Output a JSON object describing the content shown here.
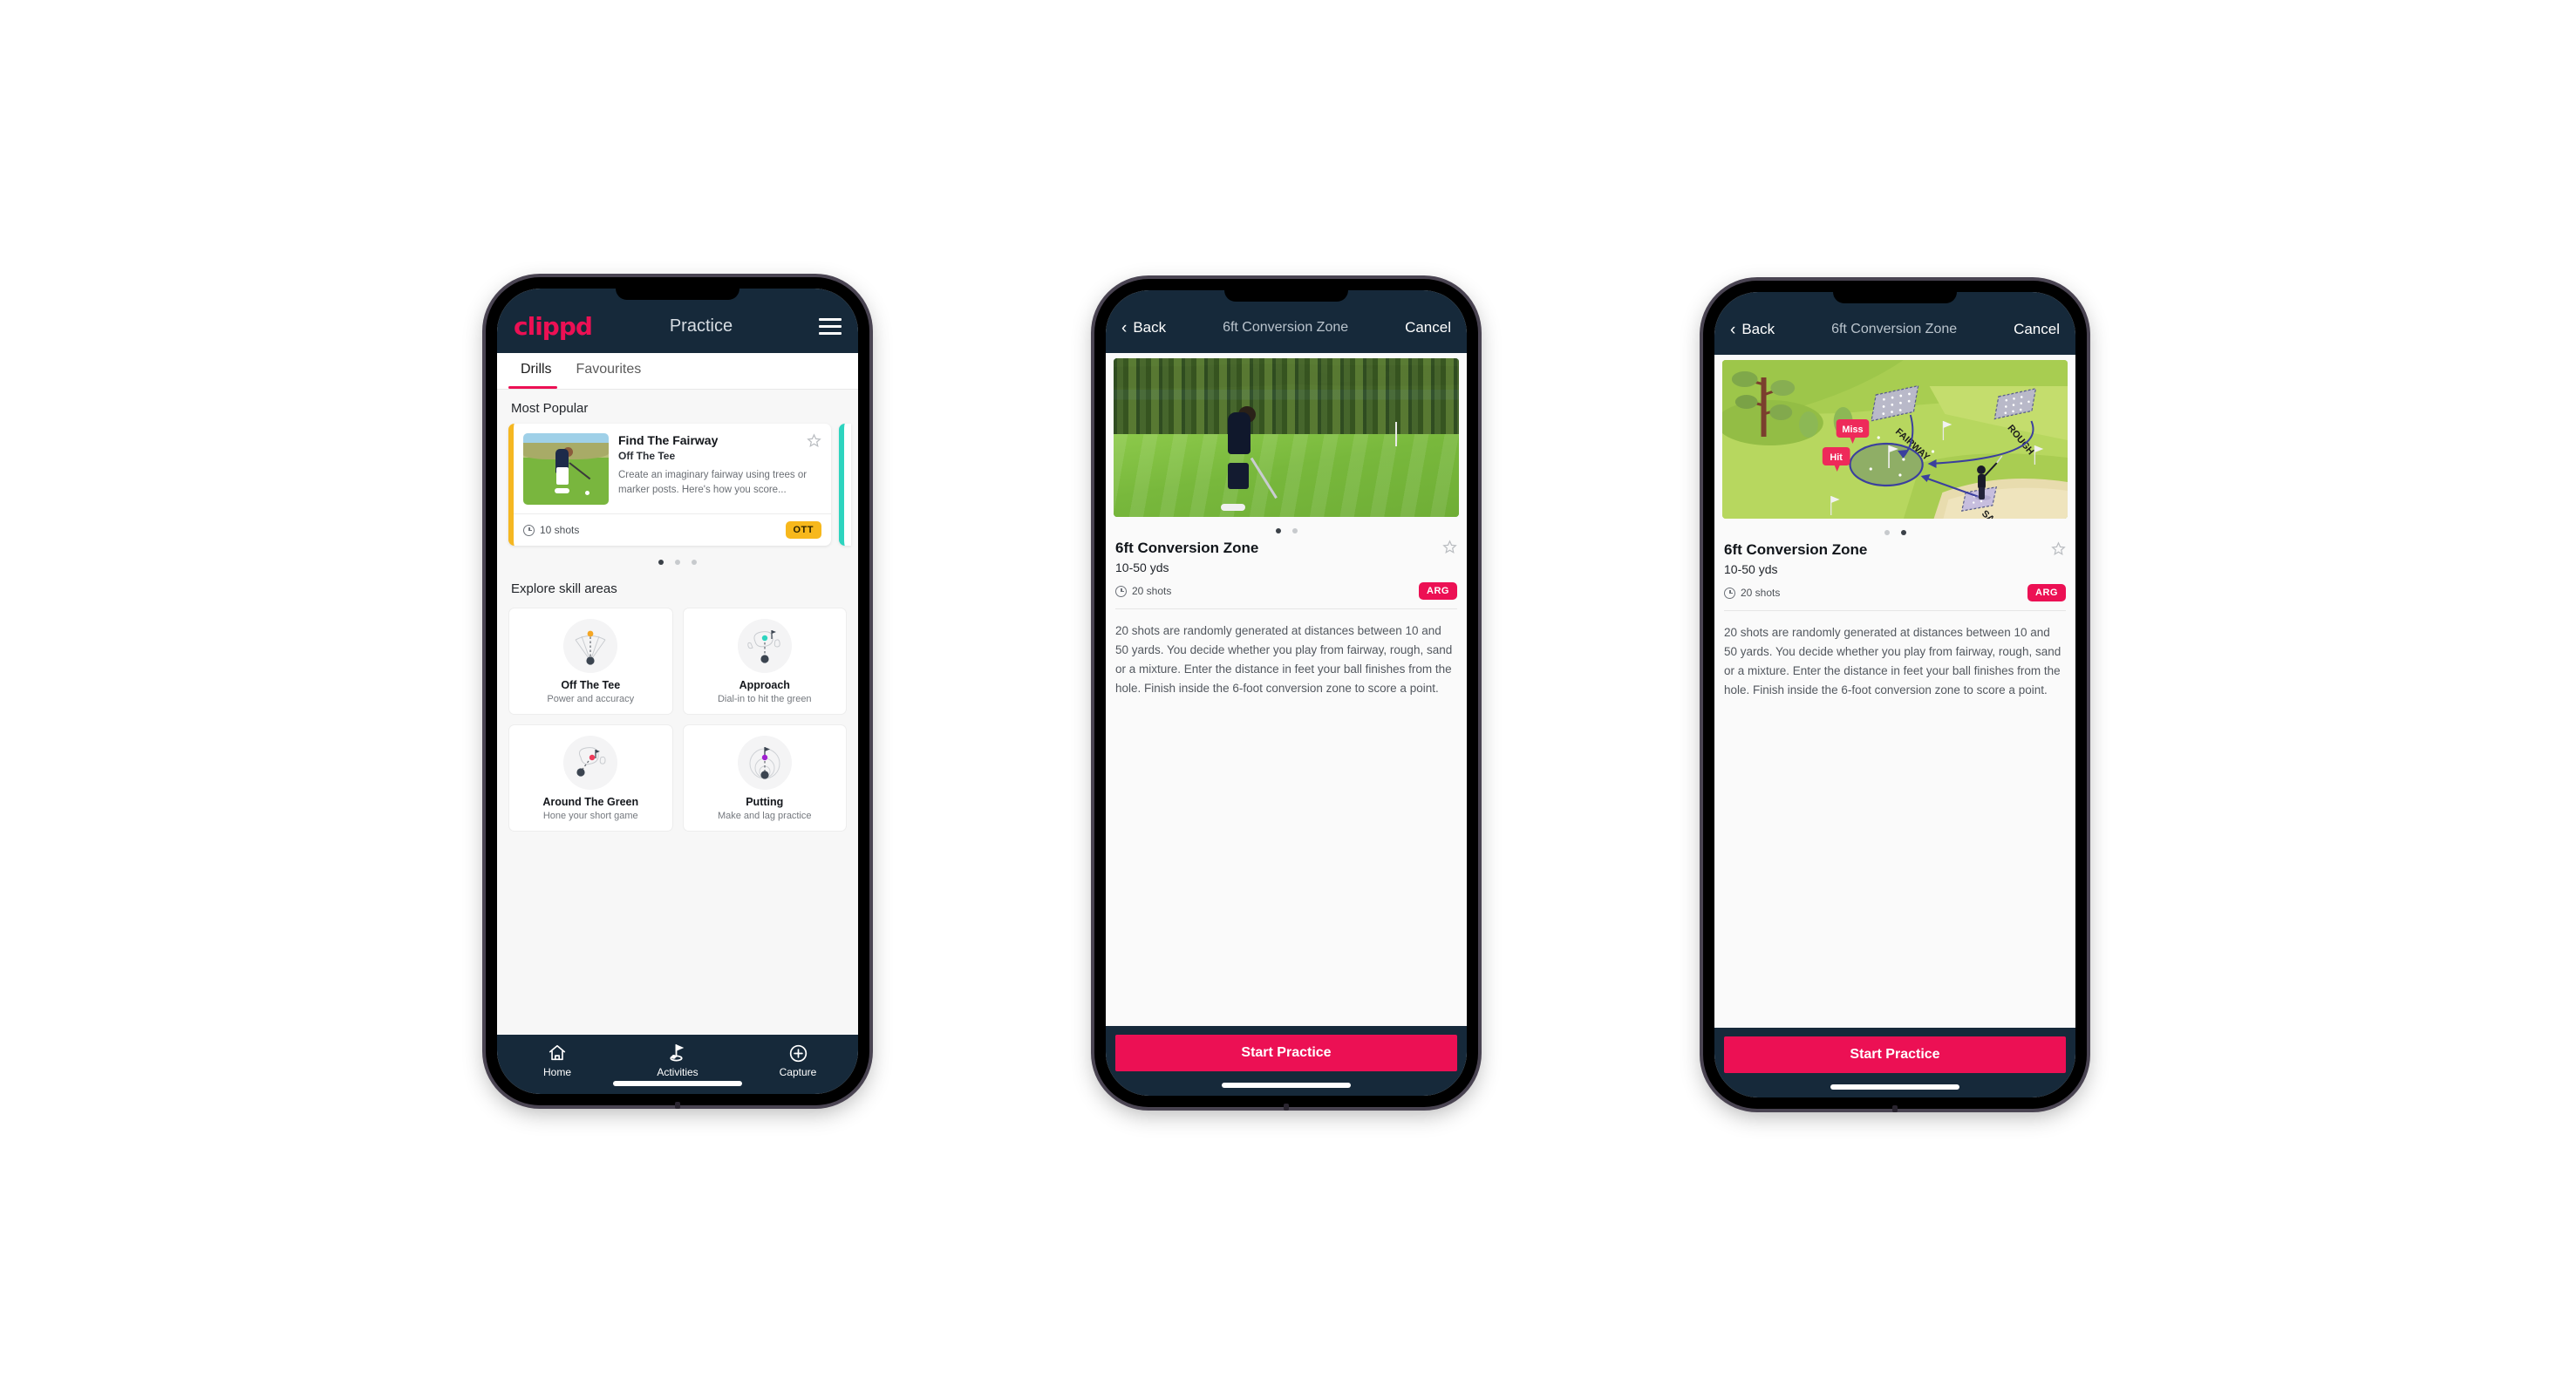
{
  "phone1": {
    "nav": {
      "brand": "clippd",
      "title": "Practice",
      "menu_icon": "hamburger-icon"
    },
    "tabs": [
      {
        "label": "Drills",
        "active": true
      },
      {
        "label": "Favourites",
        "active": false
      }
    ],
    "sections": {
      "most_popular": "Most Popular",
      "explore": "Explore skill areas"
    },
    "popular_card": {
      "title": "Find The Fairway",
      "subtitle": "Off The Tee",
      "description": "Create an imaginary fairway using trees or marker posts. Here's how you score...",
      "shots": "10 shots",
      "badge": "OTT",
      "badge_color": "#f7b81c",
      "accent_color": "#f5b721",
      "peek_accent_color": "#2dd4bf",
      "star_icon": "star-outline-icon"
    },
    "carousel_dots": {
      "count": 3,
      "active": 0
    },
    "skill_areas": [
      {
        "name": "Off The Tee",
        "desc": "Power and accuracy",
        "icon": "tee-fan-icon",
        "dot_color": "#f5a623"
      },
      {
        "name": "Approach",
        "desc": "Dial-in to hit the green",
        "icon": "green-approach-icon",
        "dot_color": "#2dd4bf"
      },
      {
        "name": "Around The Green",
        "desc": "Hone your short game",
        "icon": "chip-green-icon",
        "dot_color": "#ef3b5b"
      },
      {
        "name": "Putting",
        "desc": "Make and lag practice",
        "icon": "putting-rings-icon",
        "dot_color": "#a020d0"
      }
    ],
    "tabbar": [
      {
        "label": "Home",
        "icon": "home-icon",
        "active": false
      },
      {
        "label": "Activities",
        "icon": "golf-flag-icon",
        "active": true
      },
      {
        "label": "Capture",
        "icon": "plus-circle-icon",
        "active": false
      }
    ]
  },
  "phone2": {
    "nav": {
      "back": "Back",
      "title": "6ft Conversion Zone",
      "cancel": "Cancel",
      "back_icon": "chevron-left-icon"
    },
    "hero": "golf-chip-photo",
    "carousel_dots": {
      "count": 2,
      "active": 0
    },
    "detail": {
      "title": "6ft Conversion Zone",
      "yards": "10-50 yds",
      "shots": "20 shots",
      "badge": "ARG",
      "badge_color": "#ec1054",
      "description": "20 shots are randomly generated at distances between 10 and 50 yards. You decide whether you play from fairway, rough, sand or a mixture. Enter the distance in feet your ball finishes from the hole. Finish inside the 6-foot conversion zone to score a point.",
      "star_icon": "star-outline-icon"
    },
    "cta": "Start Practice"
  },
  "phone3": {
    "nav": {
      "back": "Back",
      "title": "6ft Conversion Zone",
      "cancel": "Cancel",
      "back_icon": "chevron-left-icon"
    },
    "hero": "golf-course-diagram",
    "diagram": {
      "zones": [
        "FAIRWAY",
        "ROUGH",
        "SAND"
      ],
      "callouts": [
        "Miss",
        "Hit"
      ],
      "callout_color": "#ee2a5a",
      "arrow_color": "#3b3f9e"
    },
    "carousel_dots": {
      "count": 2,
      "active": 1
    },
    "detail": {
      "title": "6ft Conversion Zone",
      "yards": "10-50 yds",
      "shots": "20 shots",
      "badge": "ARG",
      "badge_color": "#ec1054",
      "description": "20 shots are randomly generated at distances between 10 and 50 yards. You decide whether you play from fairway, rough, sand or a mixture. Enter the distance in feet your ball finishes from the hole. Finish inside the 6-foot conversion zone to score a point.",
      "star_icon": "star-outline-icon"
    },
    "cta": "Start Practice"
  }
}
